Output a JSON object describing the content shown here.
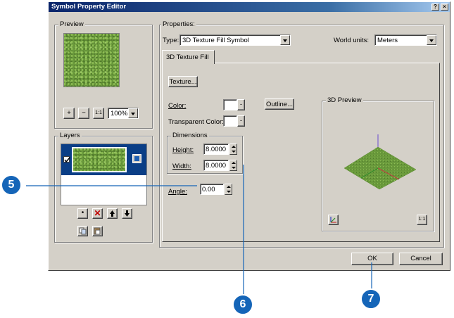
{
  "window": {
    "title": "Symbol Property Editor",
    "help_btn": "?",
    "close_btn": "×"
  },
  "preview": {
    "label": "Preview",
    "zoom_value": "100%",
    "btn_fit": "1:1",
    "btn_in": "+",
    "btn_out": "−"
  },
  "layers": {
    "label": "Layers"
  },
  "properties": {
    "label": "Properties:",
    "type_label": "Type:",
    "type_value": "3D Texture Fill Symbol",
    "units_label": "World units:",
    "units_value": "Meters",
    "tab_label": "3D Texture Fill",
    "texture_btn": "Texture...",
    "color_label": "Color:",
    "outline_btn": "Outline...",
    "transparent_label": "Transparent Color:",
    "dimensions_label": "Dimensions",
    "height_label": "Height:",
    "height_value": "8.0000",
    "width_label": "Width:",
    "width_value": "8.0000",
    "angle_label": "Angle:",
    "angle_value": "0.00",
    "preview3d_label": "3D Preview",
    "preview3d_fit": "1:1"
  },
  "footer": {
    "ok": "OK",
    "cancel": "Cancel"
  },
  "callouts": {
    "c5": "5",
    "c6": "6",
    "c7": "7"
  },
  "colors": {
    "callout": "#1565b8",
    "titlebar": "#0a246a",
    "dialog": "#d4d0c8"
  }
}
